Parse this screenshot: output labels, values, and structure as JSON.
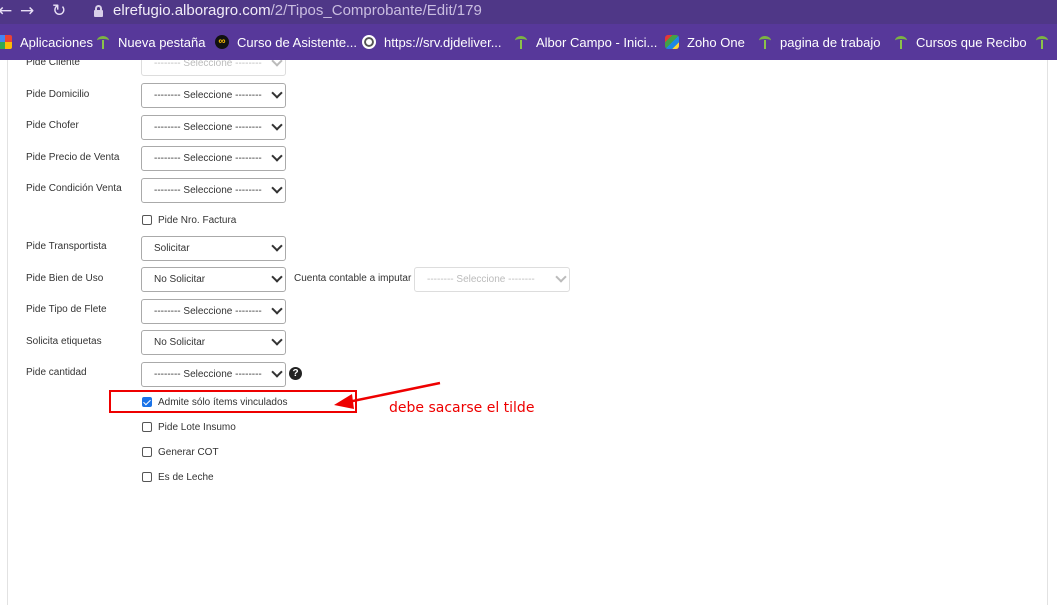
{
  "browser": {
    "back_glyph": "←",
    "forward_glyph": "→",
    "reload_glyph": "↻",
    "url_host": "elrefugio.alboragro.com",
    "url_path": "/2/Tipos_Comprobante/Edit/179"
  },
  "bookmarks": [
    {
      "label": "Aplicaciones",
      "icon": "apps-grid-icon"
    },
    {
      "label": "Nueva pestaña",
      "icon": "palm-icon"
    },
    {
      "label": "Curso de Asistente...",
      "icon": "infinity-icon"
    },
    {
      "label": "https://srv.djdeliver...",
      "icon": "globe-icon"
    },
    {
      "label": "Albor Campo - Inici...",
      "icon": "palm-icon"
    },
    {
      "label": "Zoho One",
      "icon": "zoho-icon"
    },
    {
      "label": "pagina de trabajo",
      "icon": "palm-icon"
    },
    {
      "label": "Cursos que Recibo",
      "icon": "palm-icon"
    }
  ],
  "form": {
    "placeholder": "-------- Seleccione --------",
    "fields": [
      {
        "label": "Pide Cliente",
        "value": "-------- Seleccione --------"
      },
      {
        "label": "Pide Domicilio",
        "value": "-------- Seleccione --------"
      },
      {
        "label": "Pide Chofer",
        "value": "-------- Seleccione --------"
      },
      {
        "label": "Pide Precio de Venta",
        "value": "-------- Seleccione --------"
      },
      {
        "label": "Pide Condición Venta",
        "value": "-------- Seleccione --------"
      },
      {
        "label": "Pide Transportista",
        "value": "Solicitar"
      },
      {
        "label": "Pide Bien de Uso",
        "value": "No Solicitar"
      },
      {
        "label": "Pide Tipo de Flete",
        "value": "-------- Seleccione --------"
      },
      {
        "label": "Solicita etiquetas",
        "value": "No Solicitar"
      },
      {
        "label": "Pide cantidad",
        "value": "-------- Seleccione --------"
      }
    ],
    "cuenta_contable": {
      "label": "Cuenta contable a imputar",
      "value": "-------- Seleccione --------"
    },
    "checkboxes": [
      {
        "label": "Pide Nro. Factura",
        "checked": false
      },
      {
        "label": "Admite sólo ítems vinculados",
        "checked": true
      },
      {
        "label": "Pide Lote Insumo",
        "checked": false
      },
      {
        "label": "Generar COT",
        "checked": false
      },
      {
        "label": "Es de Leche",
        "checked": false
      }
    ],
    "help_glyph": "?"
  },
  "annotation": {
    "note": "debe sacarse el tilde",
    "color": "#e00000"
  }
}
